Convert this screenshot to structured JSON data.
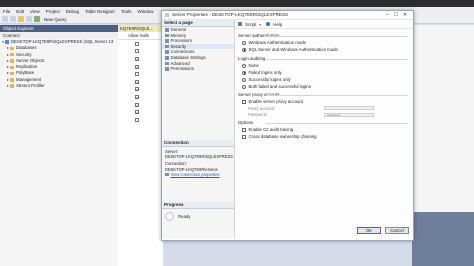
{
  "app": {
    "menu": [
      "File",
      "Edit",
      "View",
      "Project",
      "Debug",
      "Table Designer",
      "Tools",
      "Window"
    ],
    "toolbar": {
      "new_query": "New Query"
    }
  },
  "object_explorer": {
    "title": "Object Explorer",
    "connect": "Connect",
    "tree": [
      {
        "label": "DESKTOP-LKQ7E9R\\SQLEXPRESS (SQL Server 13",
        "level": 0,
        "icon": "server-icon"
      },
      {
        "label": "Databases",
        "level": 1,
        "icon": "folder-icon"
      },
      {
        "label": "Security",
        "level": 1,
        "icon": "folder-icon"
      },
      {
        "label": "Server Objects",
        "level": 1,
        "icon": "folder-icon"
      },
      {
        "label": "Replication",
        "level": 1,
        "icon": "folder-icon"
      },
      {
        "label": "PolyBase",
        "level": 1,
        "icon": "folder-icon"
      },
      {
        "label": "Management",
        "level": 1,
        "icon": "folder-icon"
      },
      {
        "label": "XEvent Profiler",
        "level": 1,
        "icon": "profiler-icon"
      }
    ]
  },
  "mid_pane": {
    "tab": "KQ7E9R\\SQLE...",
    "column_header": "Allow Nulls",
    "checks": [
      false,
      false,
      true,
      true,
      false,
      true,
      true,
      true,
      true,
      true,
      false
    ]
  },
  "dialog": {
    "title": "Server Properties - DESKTOP-LKQ7E9R\\SQLEXPRESS",
    "select_page_header": "Select a page",
    "pages": [
      "General",
      "Memory",
      "Processors",
      "Security",
      "Connections",
      "Database Settings",
      "Advanced",
      "Permissions"
    ],
    "toolbar": {
      "script": "Script",
      "help": "Help"
    },
    "connection": {
      "header": "Connection",
      "server_label": "Server:",
      "server_value": "DESKTOP-LKQ7E9R\\SQLEXPRESS",
      "conn_label": "Connection:",
      "conn_value": "DESKTOP-LKQ7E9R\\emens",
      "view_link": "View connection properties"
    },
    "progress": {
      "header": "Progress",
      "status": "Ready"
    },
    "server_auth": {
      "label": "Server authentication",
      "options": [
        "Windows Authentication mode",
        "SQL Server and Windows Authentication mode"
      ],
      "selected": 1
    },
    "login_auditing": {
      "label": "Login auditing",
      "options": [
        "None",
        "Failed logins only",
        "Successful logins only",
        "Both failed and successful logins"
      ],
      "selected": 1
    },
    "proxy": {
      "label": "Server proxy account",
      "enable": "Enable server proxy account",
      "proxy_account": "Proxy account:",
      "password": "Password:",
      "password_value": "**********"
    },
    "options": {
      "label": "Options",
      "items": [
        "Enable C2 audit tracing",
        "Cross database ownership chaining"
      ]
    },
    "buttons": {
      "ok": "OK",
      "cancel": "Cancel"
    }
  }
}
